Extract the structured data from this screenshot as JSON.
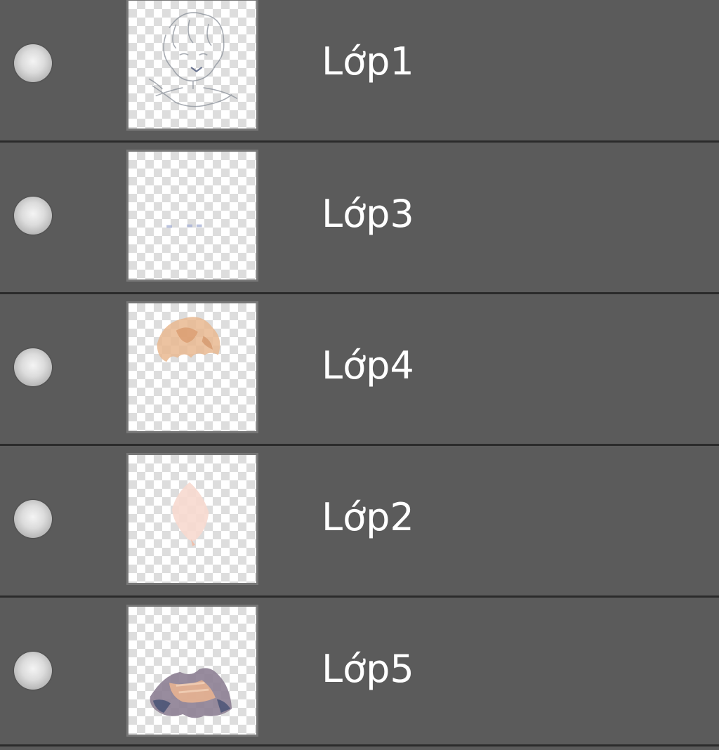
{
  "panel": {
    "layers": [
      {
        "name": "Lớp1",
        "visible": true,
        "thumbnail": "sketch-lineart"
      },
      {
        "name": "Lớp3",
        "visible": true,
        "thumbnail": "eye-dots"
      },
      {
        "name": "Lớp4",
        "visible": true,
        "thumbnail": "hair-color"
      },
      {
        "name": "Lớp2",
        "visible": true,
        "thumbnail": "skin-color"
      },
      {
        "name": "Lớp5",
        "visible": true,
        "thumbnail": "clothing-color"
      }
    ]
  },
  "colors": {
    "panel_bg": "#5b5b5b",
    "divider": "#2b2b2b",
    "text": "#ffffff"
  }
}
